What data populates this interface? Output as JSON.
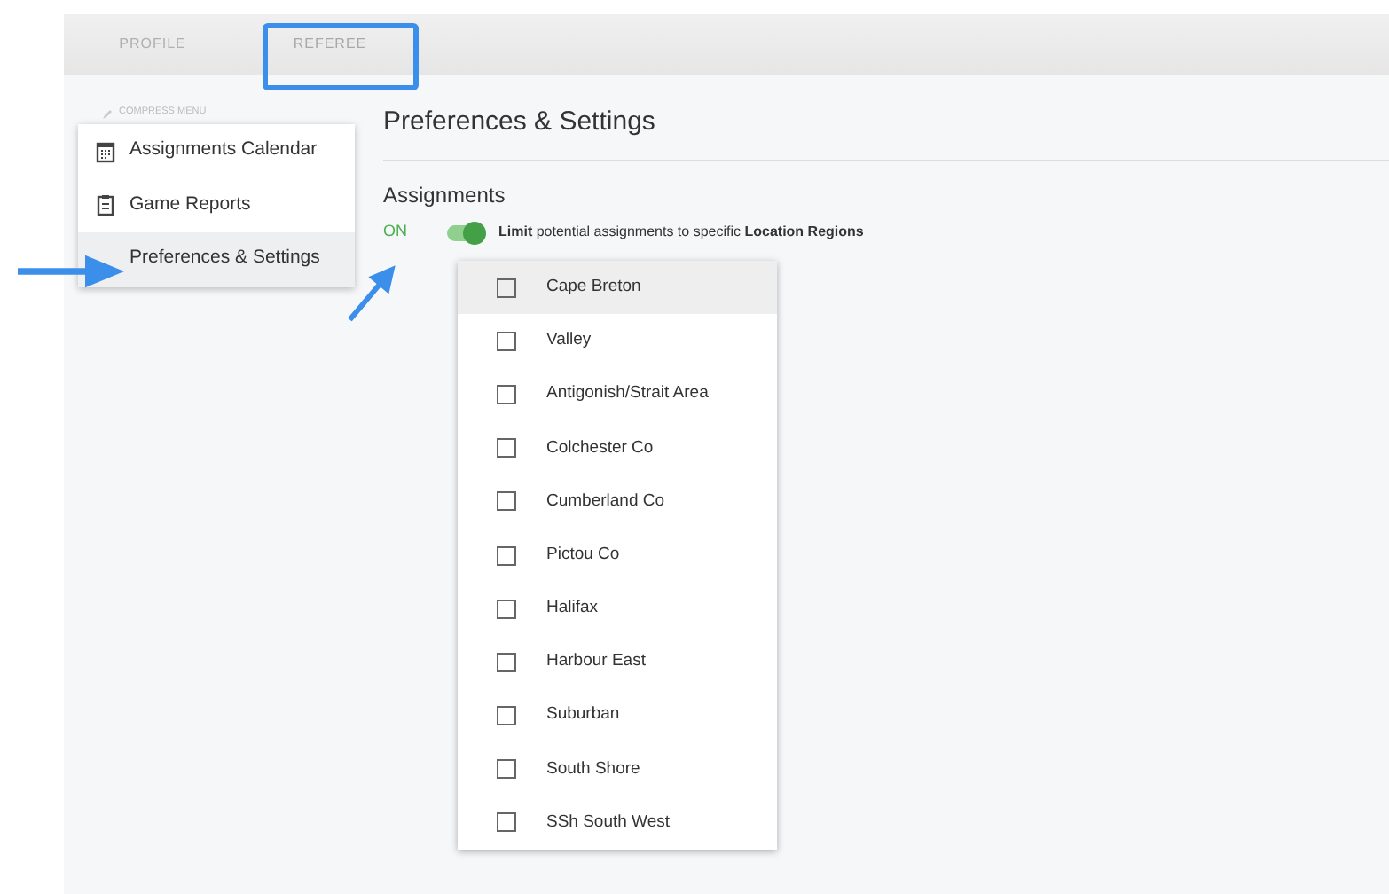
{
  "tabs": [
    {
      "label": "PROFILE",
      "selected": false
    },
    {
      "label": "REFEREE",
      "selected": true
    }
  ],
  "compress_menu": "COMPRESS MENU",
  "sidebar": {
    "items": [
      {
        "label": "Assignments Calendar",
        "kind": "calendar",
        "selected": false
      },
      {
        "label": "Game Reports",
        "kind": "clipboard",
        "selected": false
      },
      {
        "label": "Preferences & Settings",
        "kind": "none",
        "selected": true
      }
    ]
  },
  "page_title": "Preferences & Settings",
  "section": {
    "heading": "Assignments",
    "toggle": {
      "state_label": "ON",
      "on": true,
      "description": "**Limit** potential assignments to specific **Location Regions**"
    }
  },
  "regions": [
    {
      "label": "Cape Breton",
      "checked": false,
      "hovered": true
    },
    {
      "label": "Valley",
      "checked": false,
      "hovered": false
    },
    {
      "label": "Antigonish/Strait Area",
      "checked": false,
      "hovered": false
    },
    {
      "label": "Colchester Co",
      "checked": false,
      "hovered": false
    },
    {
      "label": "Cumberland Co",
      "checked": false,
      "hovered": false
    },
    {
      "label": "Pictou Co",
      "checked": false,
      "hovered": false
    },
    {
      "label": "Halifax",
      "checked": false,
      "hovered": false
    },
    {
      "label": "Harbour East",
      "checked": false,
      "hovered": false
    },
    {
      "label": "Suburban",
      "checked": false,
      "hovered": false
    },
    {
      "label": "South Shore",
      "checked": false,
      "hovered": false
    },
    {
      "label": "SSh South West",
      "checked": false,
      "hovered": false
    }
  ]
}
